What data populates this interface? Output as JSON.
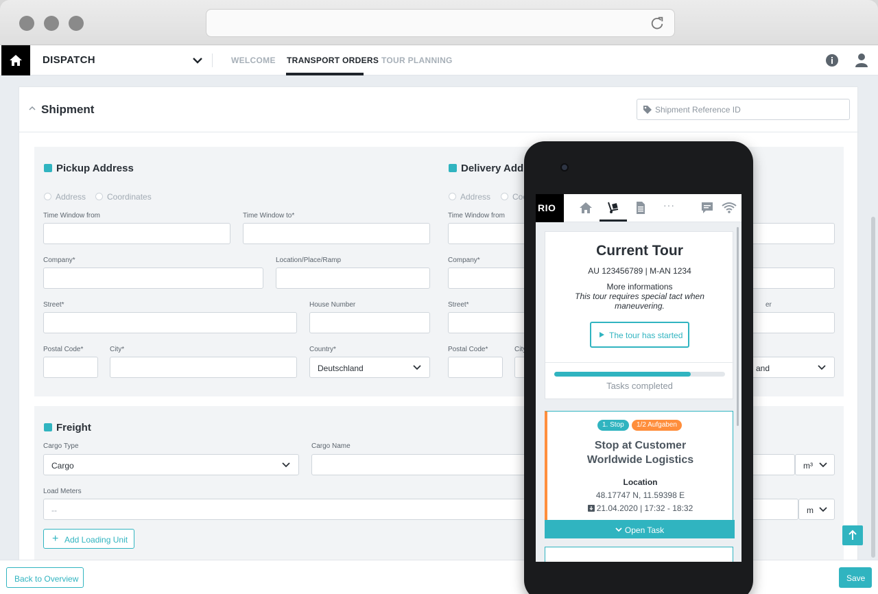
{
  "app": {
    "name": "DISPATCH",
    "tabs": [
      {
        "label": "WELCOME",
        "active": false
      },
      {
        "label": "TRANSPORT ORDERS",
        "active": true
      },
      {
        "label": "TOUR PLANNING",
        "active": false
      }
    ]
  },
  "shipment": {
    "title": "Shipment",
    "reference_placeholder": "Shipment Reference ID"
  },
  "pickup": {
    "title": "Pickup Address",
    "radio_address": "Address",
    "radio_coordinates": "Coordinates",
    "time_from": "Time Window from",
    "time_to": "Time Window to*",
    "company": "Company*",
    "location": "Location/Place/Ramp",
    "street": "Street*",
    "house_number": "House Number",
    "postal_code": "Postal Code*",
    "city": "City*",
    "country": "Country*",
    "country_value": "Deutschland"
  },
  "delivery": {
    "title": "Delivery Addr",
    "radio_address": "Address",
    "radio_coordinates": "Coo",
    "time_from": "Time Window from",
    "company": "Company*",
    "street": "Street*",
    "house_number_partial": "er",
    "postal_code": "Postal Code*",
    "city_partial": "City",
    "country_value_partial": "and"
  },
  "freight": {
    "title": "Freight",
    "cargo_type_label": "Cargo Type",
    "cargo_type_value": "Cargo",
    "cargo_name_label": "Cargo Name",
    "volume_unit": "m³",
    "load_meters_label": "Load Meters",
    "load_meters_placeholder": "--",
    "load_unit": "m",
    "add_loading_unit": "Add Loading Unit"
  },
  "footer": {
    "back": "Back to Overview",
    "save": "Save"
  },
  "mobile": {
    "brand": "RIO",
    "more": "···",
    "tour": {
      "title": "Current Tour",
      "ids": "AU 123456789   |   M-AN 1234",
      "more_info": "More informations",
      "note": "This tour requires special tact when maneuvering.",
      "status_button": "The tour has started",
      "progress": 0.8,
      "tasks_label": "Tasks completed"
    },
    "stop": {
      "stop_badge": "1. Stop",
      "tasks_badge": "1/2 Aufgaben",
      "title_line1": "Stop at Customer",
      "title_line2": "Worldwide Logistics",
      "location_label": "Location",
      "coordinates": "48.17747 N, 11.59398 E",
      "datetime": "21.04.2020 | 17:32 - 18:32",
      "open_task": "Open Task"
    }
  },
  "colors": {
    "accent": "#30b4c0",
    "orange": "#ff8e3c",
    "dark": "#1f252b"
  }
}
